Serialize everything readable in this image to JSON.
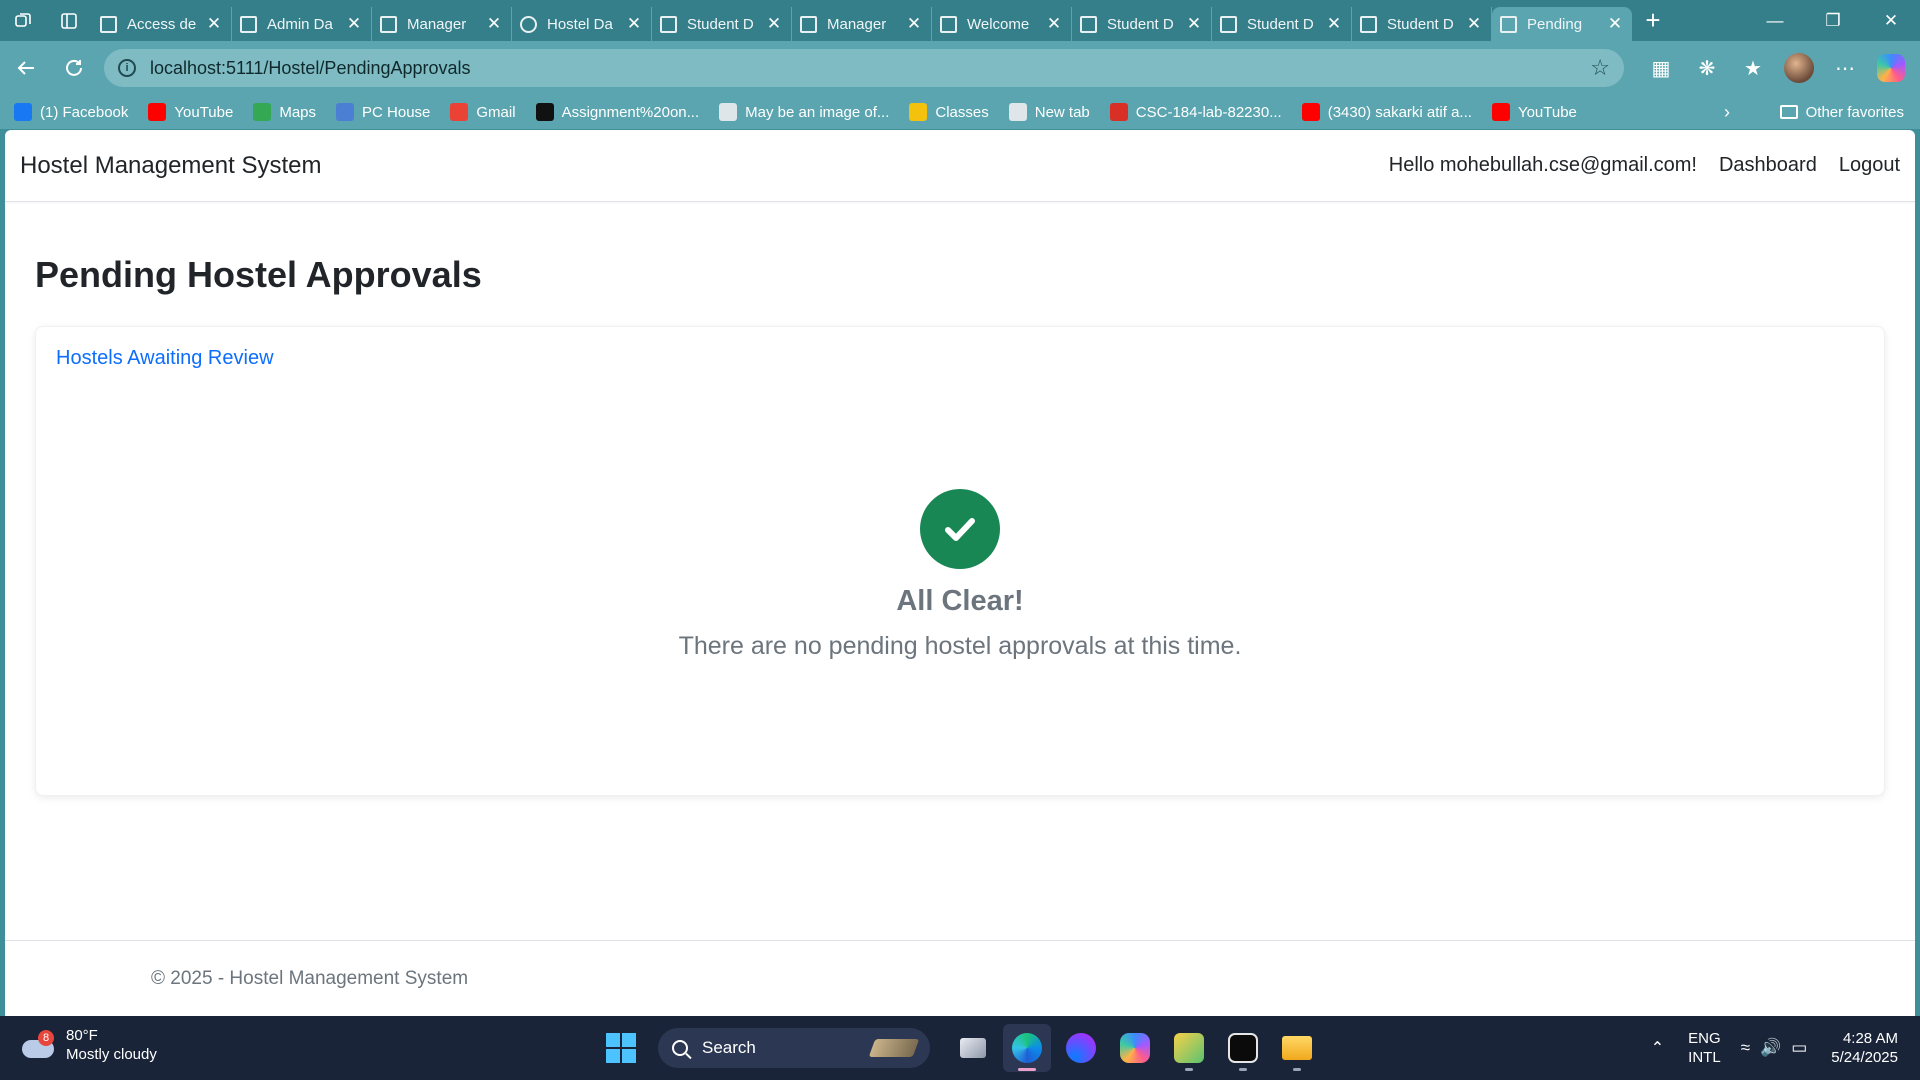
{
  "browser": {
    "tabs": [
      {
        "title": "Access de",
        "icon": "page-icon"
      },
      {
        "title": "Admin Da",
        "icon": "page-icon"
      },
      {
        "title": "Manager",
        "icon": "page-icon"
      },
      {
        "title": "Hostel Da",
        "icon": "globe-icon"
      },
      {
        "title": "Student D",
        "icon": "page-icon"
      },
      {
        "title": "Manager",
        "icon": "page-icon"
      },
      {
        "title": "Welcome",
        "icon": "page-icon"
      },
      {
        "title": "Student D",
        "icon": "page-icon"
      },
      {
        "title": "Student D",
        "icon": "page-icon"
      },
      {
        "title": "Student D",
        "icon": "page-icon"
      },
      {
        "title": "Pending",
        "icon": "page-icon",
        "active": true
      }
    ],
    "url": "localhost:5111/Hostel/PendingApprovals",
    "bookmarks": [
      {
        "label": "(1) Facebook",
        "color": "#1877f2"
      },
      {
        "label": "YouTube",
        "color": "#ff0000"
      },
      {
        "label": "Maps",
        "color": "#34a853"
      },
      {
        "label": "PC House",
        "color": "#4a7fd4"
      },
      {
        "label": "Gmail",
        "color": "#ea4335"
      },
      {
        "label": "Assignment%20on...",
        "color": "#111111"
      },
      {
        "label": "May be an image of...",
        "color": "#dfe6ea"
      },
      {
        "label": "Classes",
        "color": "#f4c20d"
      },
      {
        "label": "New tab",
        "color": "#dfe6ea"
      },
      {
        "label": "CSC-184-lab-82230...",
        "color": "#d93025"
      },
      {
        "label": "(3430) sakarki atif a...",
        "color": "#ff0000"
      },
      {
        "label": "YouTube",
        "color": "#ff0000"
      }
    ],
    "other_favorites": "Other favorites"
  },
  "app": {
    "brand": "Hostel Management System",
    "greeting": "Hello mohebullah.cse@gmail.com!",
    "nav_dashboard": "Dashboard",
    "nav_logout": "Logout",
    "page_title": "Pending Hostel Approvals",
    "card_header": "Hostels Awaiting Review",
    "empty_title": "All Clear!",
    "empty_message": "There are no pending hostel approvals at this time.",
    "footer": "© 2025 - Hostel Management System",
    "colors": {
      "link": "#0d6efd",
      "success": "#198754",
      "muted": "#6c757d"
    }
  },
  "taskbar": {
    "weather_badge": "8",
    "weather_temp": "80°F",
    "weather_desc": "Mostly cloudy",
    "search_label": "Search",
    "lang_1": "ENG",
    "lang_2": "INTL",
    "time": "4:28 AM",
    "date": "5/24/2025"
  }
}
